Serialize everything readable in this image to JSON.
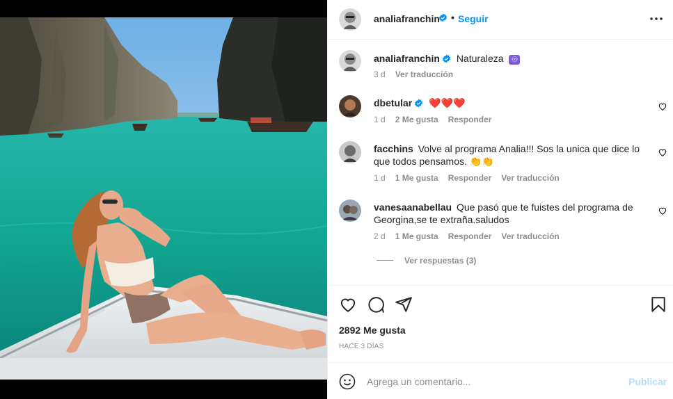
{
  "post": {
    "author": "analiafranchin",
    "follow_label": "Seguir",
    "dot": "•",
    "caption": "Naturaleza",
    "caption_emoji": "♾",
    "caption_time": "3 d",
    "caption_translate": "Ver traducción"
  },
  "comments": [
    {
      "user": "dbetular",
      "text": "❤️❤️❤️",
      "time": "1 d",
      "likes": "2 Me gusta",
      "reply": "Responder",
      "translate": ""
    },
    {
      "user": "facchins",
      "text": "Volve al programa Analia!!! Sos la unica que dice lo que todos pensamos. 👏👏",
      "time": "1 d",
      "likes": "1 Me gusta",
      "reply": "Responder",
      "translate": "Ver traducción"
    },
    {
      "user": "vanesaanabellau",
      "text": "Que pasó que te fuistes del programa de Georgina,se te extraña.saludos",
      "time": "2 d",
      "likes": "1 Me gusta",
      "reply": "Responder",
      "translate": "Ver traducción"
    }
  ],
  "view_replies": "Ver respuestas (3)",
  "likes_count": "2892 Me gusta",
  "posted_ago": "HACE 3 DÍAS",
  "add_comment": {
    "placeholder": "Agrega un comentario...",
    "publish": "Publicar"
  },
  "colors": {
    "accent": "#0095f6",
    "verified": "#0095f6",
    "muted": "#8e8e8e",
    "heart": "#ed4956"
  },
  "icons": [
    "verified-badge-icon",
    "more-options-icon",
    "heart-icon",
    "comment-icon",
    "share-icon",
    "bookmark-icon",
    "emoji-icon",
    "infinity-icon"
  ]
}
